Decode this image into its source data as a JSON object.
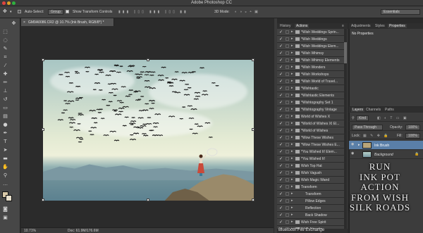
{
  "app_title": "Adobe Photoshop CC",
  "options_bar": {
    "auto_select_label": "Auto-Select:",
    "auto_select_value": "Group",
    "show_transform_label": "Show Transform Controls",
    "mode_label": "3D Mode:",
    "workspace": "Essentials"
  },
  "document": {
    "tab_title": "GM9A0086.CR2 @ 10.7% (Ink Brush, RGB/8*) *",
    "zoom": "10.71%",
    "doc_info": "Doc: 61.9M/176.6M"
  },
  "actions_panel": {
    "tabs": [
      "History",
      "Actions"
    ],
    "active_tab": "Actions",
    "items": [
      {
        "name": "*Wish Weddings Sprin...",
        "sub": false
      },
      {
        "name": "*Wish Weddings",
        "sub": false
      },
      {
        "name": "*Wish Weddings Elem...",
        "sub": false
      },
      {
        "name": "*Wish Whimsy",
        "sub": false
      },
      {
        "name": "*Wish Whimsy Elements",
        "sub": false
      },
      {
        "name": "*Wish Wonders",
        "sub": false
      },
      {
        "name": "*Wish Workshops",
        "sub": false
      },
      {
        "name": "*Wish World of Travel...",
        "sub": false
      },
      {
        "name": "*Wishtastic",
        "sub": false
      },
      {
        "name": "*Wishtastic Elements",
        "sub": false
      },
      {
        "name": "*Wishtography Set 1",
        "sub": false
      },
      {
        "name": "*Wishtography Vintage",
        "sub": false
      },
      {
        "name": "World of Wishes X",
        "sub": false
      },
      {
        "name": "*World of Wishes XI El...",
        "sub": false
      },
      {
        "name": "*World of Wishes",
        "sub": false
      },
      {
        "name": "*Wow These Wishes",
        "sub": false
      },
      {
        "name": "*Wow These Wishes E...",
        "sub": false
      },
      {
        "name": "*You Wished It! Elem...",
        "sub": false
      },
      {
        "name": "*You Wished It!",
        "sub": false
      },
      {
        "name": "Wish Top Hat",
        "sub": false
      },
      {
        "name": "Wish Vagush",
        "sub": false
      },
      {
        "name": "Wish Magic Wand",
        "sub": false
      },
      {
        "name": "Transform",
        "sub": false
      },
      {
        "name": "Transform",
        "sub": true
      },
      {
        "name": "Pillow Edges",
        "sub": true
      },
      {
        "name": "Reflection",
        "sub": true
      },
      {
        "name": "Back Shadow",
        "sub": true
      },
      {
        "name": "Wish Free Spirit",
        "sub": false
      },
      {
        "name": "Wish-Nanette",
        "sub": false
      }
    ],
    "bottom_text": "Bluetooth File Exchange"
  },
  "properties_panel": {
    "tabs": [
      "Adjustments",
      "Styles",
      "Properties"
    ],
    "active_tab": "Properties",
    "message": "No Properties"
  },
  "layers_panel": {
    "tabs": [
      "Layers",
      "Channels",
      "Paths"
    ],
    "active_tab": "Layers",
    "kind_label": "Kind",
    "blend_mode": "Pass Through",
    "opacity_label": "Opacity:",
    "opacity": "100%",
    "lock_label": "Lock:",
    "fill_label": "Fill:",
    "fill": "100%",
    "layers": [
      {
        "name": "Ink Brush",
        "selected": true
      },
      {
        "name": "Background",
        "selected": false
      }
    ]
  },
  "overlay_text": [
    "RUN",
    "INK POT",
    "ACTION",
    "FROM WISH",
    "SILK ROADS"
  ],
  "colors": {
    "accent_selected": "#5a7fa8",
    "foreground_swatch": "#d9c9a8",
    "background_swatch": "#e8e0cc"
  }
}
